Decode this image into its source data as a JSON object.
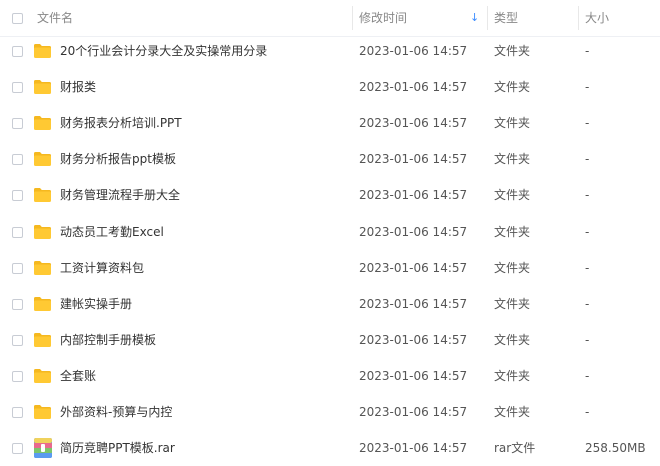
{
  "header": {
    "name": "文件名",
    "time": "修改时间",
    "sort_indicator": "↓",
    "type": "类型",
    "size": "大小"
  },
  "files": [
    {
      "name": "20个行业会计分录大全及实操常用分录",
      "time": "2023-01-06 14:57",
      "type": "文件夹",
      "size": "-",
      "icon": "folder-icon"
    },
    {
      "name": "财报类",
      "time": "2023-01-06 14:57",
      "type": "文件夹",
      "size": "-",
      "icon": "folder-icon"
    },
    {
      "name": "财务报表分析培训.PPT",
      "time": "2023-01-06 14:57",
      "type": "文件夹",
      "size": "-",
      "icon": "folder-icon"
    },
    {
      "name": "财务分析报告ppt模板",
      "time": "2023-01-06 14:57",
      "type": "文件夹",
      "size": "-",
      "icon": "folder-icon"
    },
    {
      "name": "财务管理流程手册大全",
      "time": "2023-01-06 14:57",
      "type": "文件夹",
      "size": "-",
      "icon": "folder-icon"
    },
    {
      "name": "动态员工考勤Excel",
      "time": "2023-01-06 14:57",
      "type": "文件夹",
      "size": "-",
      "icon": "folder-icon"
    },
    {
      "name": "工资计算资料包",
      "time": "2023-01-06 14:57",
      "type": "文件夹",
      "size": "-",
      "icon": "folder-icon"
    },
    {
      "name": "建帐实操手册",
      "time": "2023-01-06 14:57",
      "type": "文件夹",
      "size": "-",
      "icon": "folder-icon"
    },
    {
      "name": "内部控制手册模板",
      "time": "2023-01-06 14:57",
      "type": "文件夹",
      "size": "-",
      "icon": "folder-icon"
    },
    {
      "name": "全套账",
      "time": "2023-01-06 14:57",
      "type": "文件夹",
      "size": "-",
      "icon": "folder-icon"
    },
    {
      "name": "外部资料-预算与内控",
      "time": "2023-01-06 14:57",
      "type": "文件夹",
      "size": "-",
      "icon": "folder-icon"
    },
    {
      "name": "简历竞聘PPT模板.rar",
      "time": "2023-01-06 14:57",
      "type": "rar文件",
      "size": "258.50MB",
      "icon": "rar-archive-icon"
    }
  ],
  "colors": {
    "folder": "#ffc933",
    "folder_tab": "#f5b81f",
    "sort_arrow": "#3b8cff",
    "header_text": "#888888",
    "row_text": "#333333"
  }
}
